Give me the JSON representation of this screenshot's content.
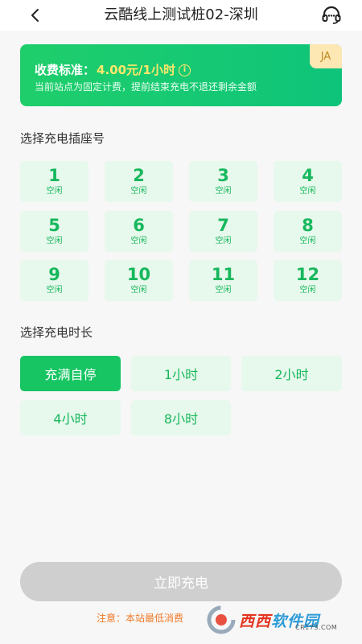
{
  "header": {
    "title": "云酷线上测试桩02-深圳",
    "back_icon": "chevron-left-icon",
    "support_icon": "headset-icon"
  },
  "pricing": {
    "label": "收费标准：",
    "value": "4.00元/1小时",
    "note": "当前站点为固定计费，提前结束充电不退还剩余金额",
    "badge": "JA",
    "info_icon": "info-icon",
    "colors": {
      "card": "#1fce6b",
      "value": "#ffe86b",
      "badge_bg": "#fde7b3"
    }
  },
  "sockets": {
    "title": "选择充电插座号",
    "items": [
      {
        "number": "1",
        "status": "空闲"
      },
      {
        "number": "2",
        "status": "空闲"
      },
      {
        "number": "3",
        "status": "空闲"
      },
      {
        "number": "4",
        "status": "空闲"
      },
      {
        "number": "5",
        "status": "空闲"
      },
      {
        "number": "6",
        "status": "空闲"
      },
      {
        "number": "7",
        "status": "空闲"
      },
      {
        "number": "8",
        "status": "空闲"
      },
      {
        "number": "9",
        "status": "空闲"
      },
      {
        "number": "10",
        "status": "空闲"
      },
      {
        "number": "11",
        "status": "空闲"
      },
      {
        "number": "12",
        "status": "空闲"
      }
    ]
  },
  "duration": {
    "title": "选择充电时长",
    "options": [
      {
        "label": "充满自停",
        "selected": true
      },
      {
        "label": "1小时",
        "selected": false
      },
      {
        "label": "2小时",
        "selected": false
      },
      {
        "label": "4小时",
        "selected": false
      },
      {
        "label": "8小时",
        "selected": false
      }
    ]
  },
  "footer": {
    "charge_button": "立即充电",
    "notice": "注意：本站最低消费",
    "accent": "#17c563"
  },
  "watermark": {
    "text_a": "西西",
    "text_b": "软件园",
    "sub": "CR173.COM"
  }
}
